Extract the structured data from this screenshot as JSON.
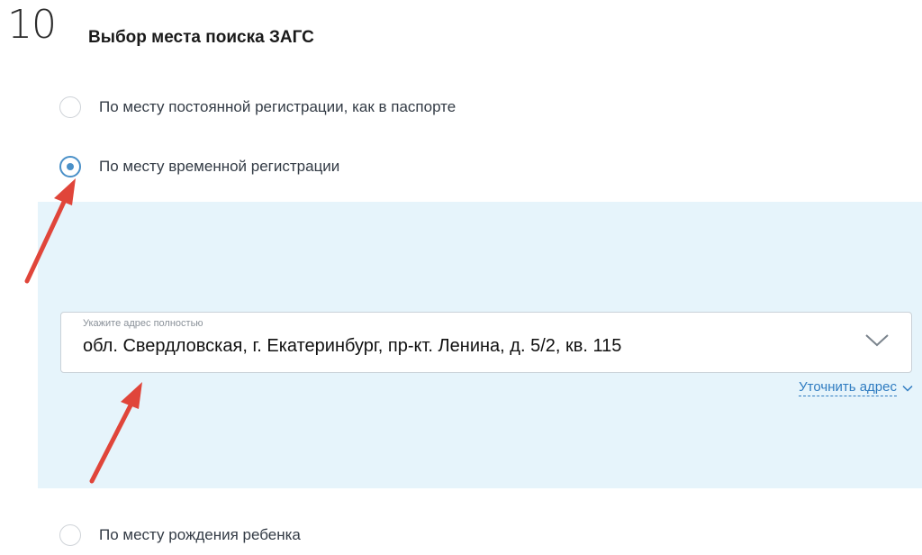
{
  "step": {
    "number": "10",
    "title": "Выбор места поиска ЗАГС"
  },
  "options": [
    {
      "label": "По месту постоянной регистрации, как в паспорте",
      "checked": false
    },
    {
      "label": "По месту временной регистрации",
      "checked": true
    },
    {
      "label": "По месту рождения ребенка",
      "checked": false
    }
  ],
  "address": {
    "placeholder": "Укажите адрес полностью",
    "value": "обл. Свердловская, г. Екатеринбург, пр-кт. Ленина, д. 5/2, кв. 115",
    "dropdown_icon": "chevron-down-icon"
  },
  "refine": {
    "label": "Уточнить адрес",
    "icon": "chevron-down-icon"
  },
  "colors": {
    "accent": "#4a90c8",
    "link": "#2f7cc1",
    "panel_bg": "#e6f4fb",
    "annotation_arrow": "#e0453a"
  }
}
